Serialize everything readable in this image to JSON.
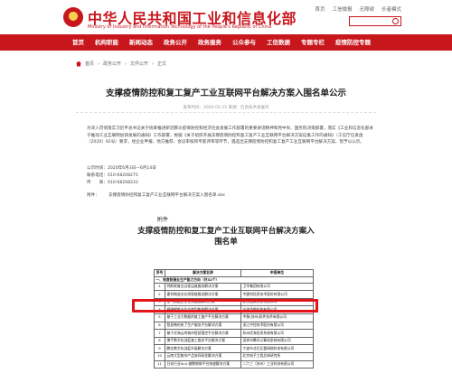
{
  "header": {
    "title": "中华人民共和国工业和信息化部",
    "subtitle": "Ministry of Industry and Information Technology of the People's Republic of China",
    "links": [
      "首页",
      "工信微报",
      "无障碍",
      "长者模式"
    ],
    "search_placeholder": ""
  },
  "nav": {
    "items": [
      "首页",
      "机构职能",
      "新闻动态",
      "政务公开",
      "政务服务",
      "公众参与",
      "工信数据",
      "专题专栏",
      "疫情防控专题"
    ]
  },
  "breadcrumb": [
    "首页",
    "政务公开",
    "文件公开",
    "正文"
  ],
  "article": {
    "title": "支撑疫情防控和复工复产工业互联网平台解决方案入围名单公示",
    "meta": "发布时间：2020-05-15 来源：信息技术发展司",
    "paragraphs": [
      "为深入贯彻落实习近平总书记关于统筹推进新冠肺炎疫情防控和经济社会发展工作部署的重要讲话精神和党中央、国务院决策部署，落实《工业和信息化部关于推动工业互联网加快发展的通知》工作部署，根据《关于组织开展支撑疫情防控和复工复产工业互联网平台解决方案征集工作的通知》（工信厅信发函〔2020〕92号）要求，经企业申报、地方推荐、会议审核和专家评审等环节，遴选出支撑疫情防控和复工复产工业互联网平台解决方案，现予以公示。"
    ],
    "period": "公示时间：2020年6月3日—6月14日",
    "phone": "联系电话：010-68208275",
    "fax": "传　　真：010-68208233",
    "attachment_label": "附件：",
    "attachment": "支撑疫情防控和复工复产工业互联网平台解决方案入围名单.doc"
  },
  "annex": {
    "label": "附件",
    "title": "支撑疫情防控和复工复产工业互联网平台解决方案入围名单",
    "columns": [
      "序号",
      "解决方案名称",
      "申报单位"
    ],
    "category": "一、恢复制造业生产能力方向（共32个）",
    "rows": [
      [
        "1",
        "特斯联复业远程运维服务解决方案",
        "卫华集团有限公司"
      ],
      [
        "2",
        "建材制造业在线智能服务解决方案",
        "中建材信息技术股份有限公司"
      ],
      [
        "3",
        "金气制造企业在线运维解决方案",
        "北京国双科技有限公司"
      ],
      [
        "4",
        "精弹钢铁业生产转型能效解决方案",
        "宁波华能软件有限公司"
      ],
      [
        "5",
        "基于工业大数据的复工复产平台解决方案",
        "中移(苏州)软件技术有限公司"
      ],
      [
        "6",
        "智慧畅的央了生产服务平台解决方案",
        "浙江中控技术股份有限公司"
      ],
      [
        "7",
        "基于优海云的城市智慧管控平台解决方案",
        "杭州优海信息系统有限公司"
      ],
      [
        "8",
        "携手数字化战疫复工服务平台解决方案",
        "深圳市腾讯计算机系统有限公司"
      ],
      [
        "9",
        "鹏实数字化战疫升级解决方案",
        "宁波市北仑区委网络科技有限公司"
      ],
      [
        "10",
        "云南大型复杂产品协同研发解决方案",
        "北京电子工程总体研究所"
      ],
      [
        "11",
        "日化行业Ann-基数物联平台快速解决方案",
        "二六三（苏州）工业科技有限公司"
      ]
    ]
  },
  "colors": {
    "brand_red": "#c8161d",
    "highlight_red": "#e4141b"
  }
}
